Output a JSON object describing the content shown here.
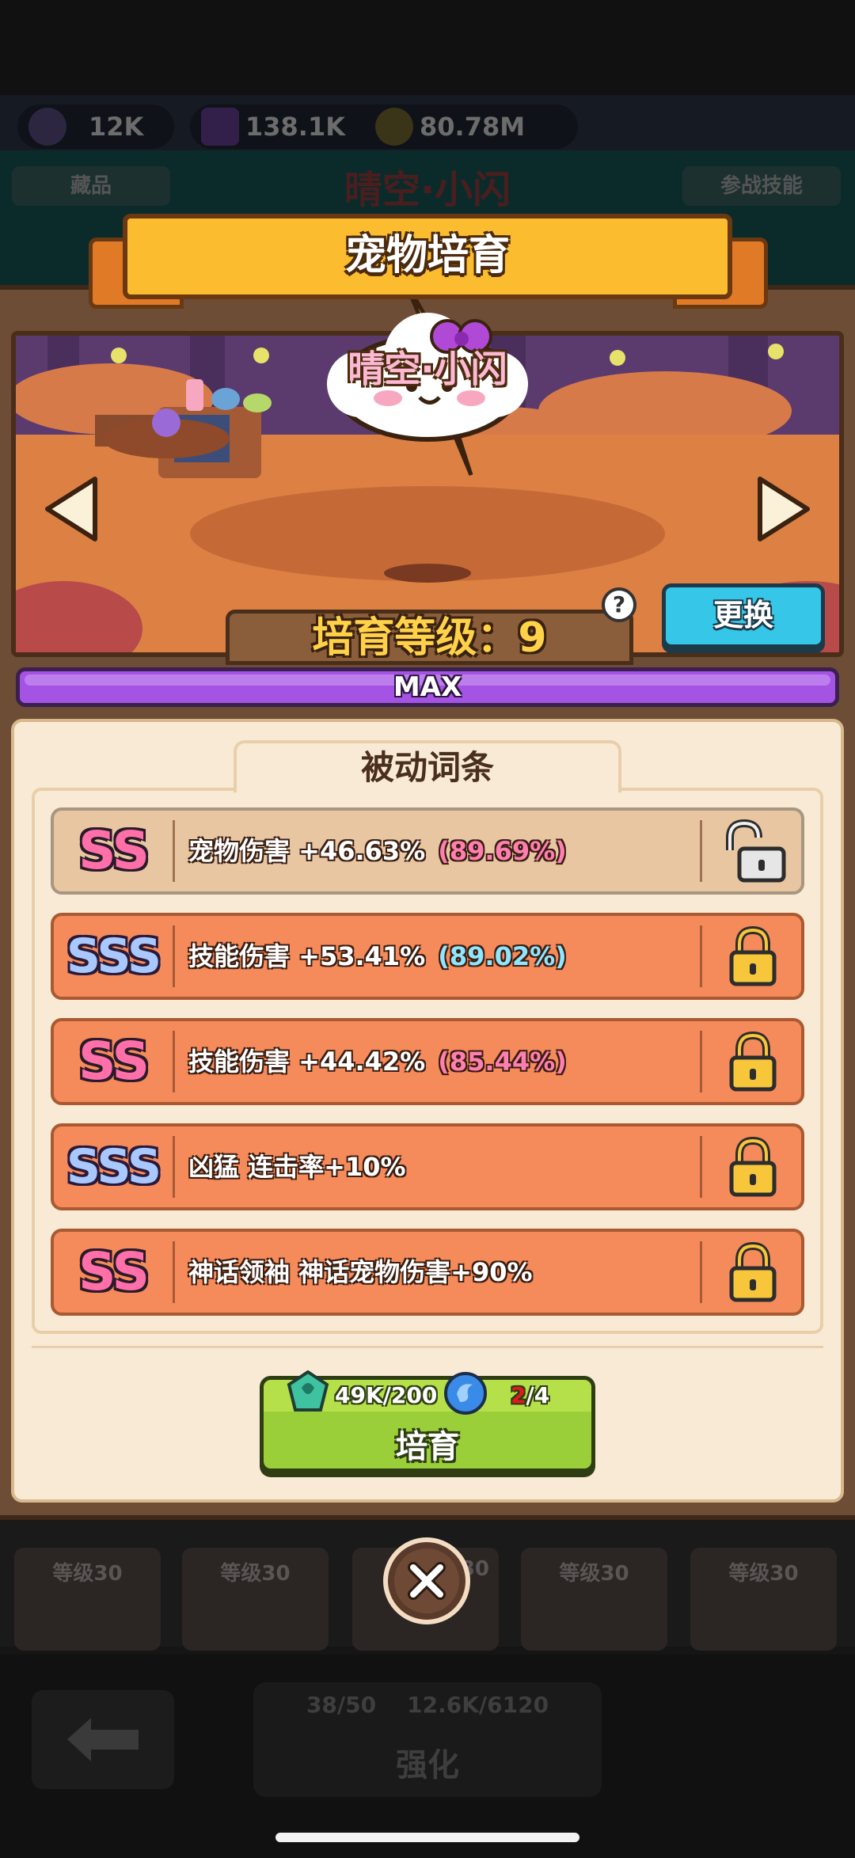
{
  "resources": [
    {
      "icon": "potion-icon",
      "value": "12K"
    },
    {
      "icon": "cube-icon",
      "value": "138.1K"
    },
    {
      "icon": "key-icon",
      "value": "80.78M"
    }
  ],
  "background": {
    "left_tag": "藏品",
    "title": "晴空·小闪",
    "right_tag": "参战技能",
    "cards": [
      {
        "label": "等级30"
      },
      {
        "label": "等级30"
      },
      {
        "label": "30"
      },
      {
        "label": "等级30"
      },
      {
        "label": "等级30"
      }
    ],
    "upgrade": {
      "cost1": "38/50",
      "cost2": "12.6K/6120",
      "label": "强化"
    }
  },
  "dialog": {
    "title": "宠物培育",
    "pet_name": "晴空·小闪",
    "level_text": "培育等级：9",
    "help": "?",
    "change_label": "更换",
    "progress_label": "MAX",
    "progress_fraction": 1.0,
    "passive_title": "被动词条",
    "rows": [
      {
        "grade": "SS",
        "grade_style": "ss",
        "text": "宠物伤害 +46.63%",
        "pct": "(89.69%)",
        "pct_color": "pink",
        "locked": false
      },
      {
        "grade": "SSS",
        "grade_style": "sss",
        "text": "技能伤害 +53.41%",
        "pct": "(89.02%)",
        "pct_color": "blue",
        "locked": true
      },
      {
        "grade": "SS",
        "grade_style": "ss",
        "text": "技能伤害 +44.42%",
        "pct": "(85.44%)",
        "pct_color": "pink",
        "locked": true
      },
      {
        "grade": "SSS",
        "grade_style": "sss",
        "text": "凶猛 连击率+10%",
        "pct": "",
        "pct_color": "",
        "locked": true
      },
      {
        "grade": "SS",
        "grade_style": "ss",
        "text": "神话领袖 神话宠物伤害+90%",
        "pct": "",
        "pct_color": "",
        "locked": true
      }
    ],
    "cultivate": {
      "cost1": "49K/200",
      "cost2_have": "2",
      "cost2_need": "/4",
      "label": "培育"
    }
  },
  "colors": {
    "accent_gold": "#fbbd2f",
    "change_button": "#36c6e8",
    "max_bar": "#a553e3",
    "cultivate_button": "#9bcf3a",
    "row_bg": "#f58a5a",
    "row_unlocked_bg": "#e8c6a2"
  }
}
